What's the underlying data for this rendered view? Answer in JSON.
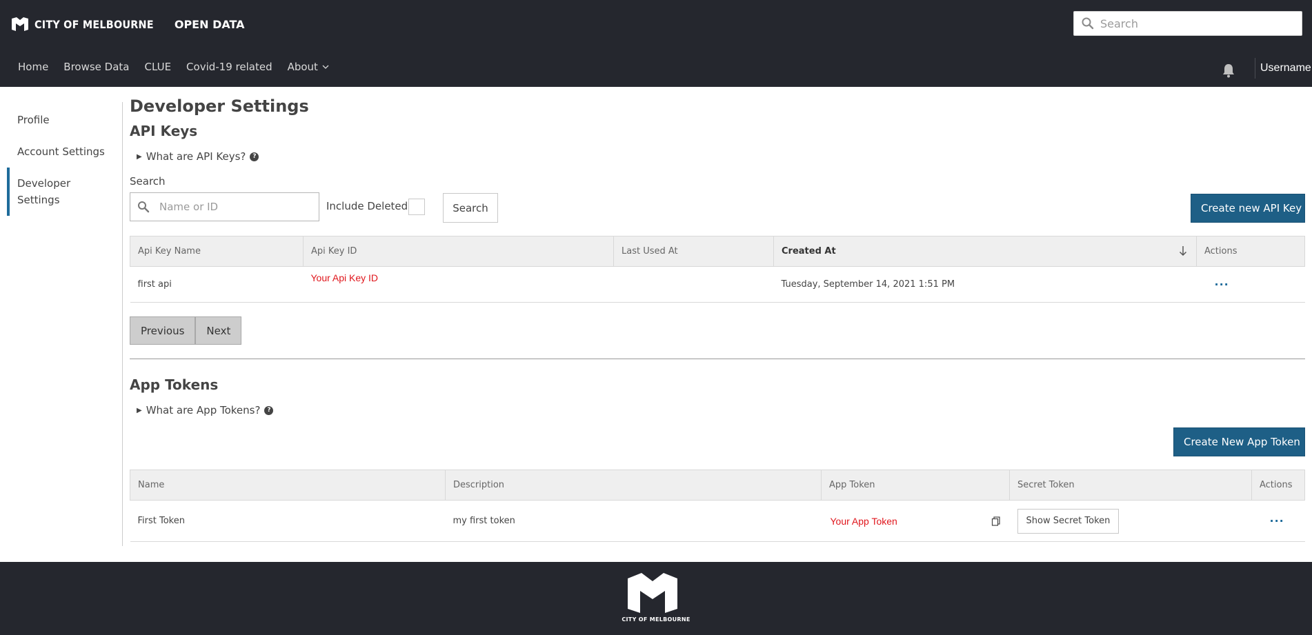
{
  "header": {
    "brand_name": "CITY OF MELBOURNE",
    "brand_sub": "OPEN DATA",
    "search_placeholder": "Search",
    "nav": [
      "Home",
      "Browse Data",
      "CLUE",
      "Covid-19 related",
      "About"
    ],
    "username": "Username"
  },
  "sidebar": {
    "items": [
      "Profile",
      "Account Settings",
      "Developer Settings"
    ],
    "active_index": 2
  },
  "page": {
    "title": "Developer Settings"
  },
  "api_keys": {
    "title": "API Keys",
    "disclosure": "What are API Keys?",
    "search_label": "Search",
    "search_placeholder": "Name or ID",
    "include_deleted_label": "Include Deleted",
    "search_button": "Search",
    "create_button": "Create new API Key",
    "columns": [
      "Api Key Name",
      "Api Key ID",
      "Last Used At",
      "Created At",
      "Actions"
    ],
    "sorted_column": "Created At",
    "rows": [
      {
        "name": "first api",
        "id": "Your Api Key ID",
        "last_used": "",
        "created": "Tuesday, September 14, 2021 1:51 PM",
        "actions": "···"
      }
    ],
    "pager": {
      "previous": "Previous",
      "next": "Next"
    }
  },
  "app_tokens": {
    "title": "App Tokens",
    "disclosure": "What are App Tokens?",
    "create_button": "Create New App Token",
    "columns": [
      "Name",
      "Description",
      "App Token",
      "Secret Token",
      "Actions"
    ],
    "rows": [
      {
        "name": "First Token",
        "description": "my first token",
        "app_token": "Your App Token",
        "secret_button": "Show Secret Token",
        "actions": "···"
      }
    ]
  },
  "footer": {
    "brand": "CITY OF MELBOURNE"
  },
  "colors": {
    "header_bg": "#25272e",
    "primary": "#1e5f86",
    "accent": "#1e6b9a",
    "highlight_red": "#e0161c"
  }
}
